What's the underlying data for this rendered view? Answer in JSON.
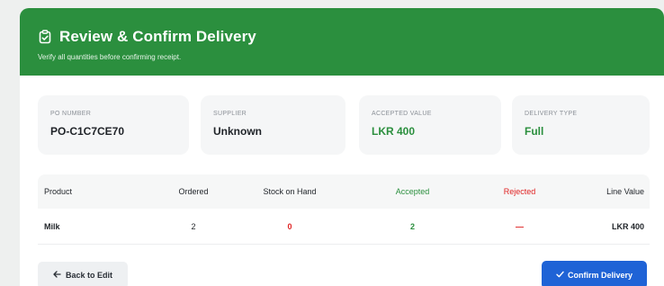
{
  "modal": {
    "title": "Review & Confirm Delivery",
    "subtitle": "Verify all quantities before confirming receipt.",
    "title_icon": "clipboard-check-icon"
  },
  "summary": {
    "po_number": {
      "label": "PO NUMBER",
      "value": "PO-C1C7CE70"
    },
    "supplier": {
      "label": "SUPPLIER",
      "value": "Unknown"
    },
    "accepted_value": {
      "label": "ACCEPTED VALUE",
      "value": "LKR 400"
    },
    "delivery_type": {
      "label": "DELIVERY TYPE",
      "value": "Full"
    }
  },
  "table": {
    "headers": {
      "product": "Product",
      "ordered": "Ordered",
      "stock_on_hand": "Stock on Hand",
      "accepted": "Accepted",
      "rejected": "Rejected",
      "line_value": "Line Value"
    },
    "rows": [
      {
        "product": "Milk",
        "ordered": "2",
        "stock_on_hand": "0",
        "accepted": "2",
        "rejected": "—",
        "line_value": "LKR 400"
      }
    ]
  },
  "footer": {
    "back_label": "Back to Edit",
    "back_icon": "arrow-left-icon",
    "confirm_label": "Confirm Delivery",
    "confirm_icon": "check-icon"
  },
  "colors": {
    "header_green": "#2b8f3e",
    "accent_green": "#2b8f3e",
    "rejected_red": "#e02424",
    "confirm_blue": "#1f63d6"
  }
}
